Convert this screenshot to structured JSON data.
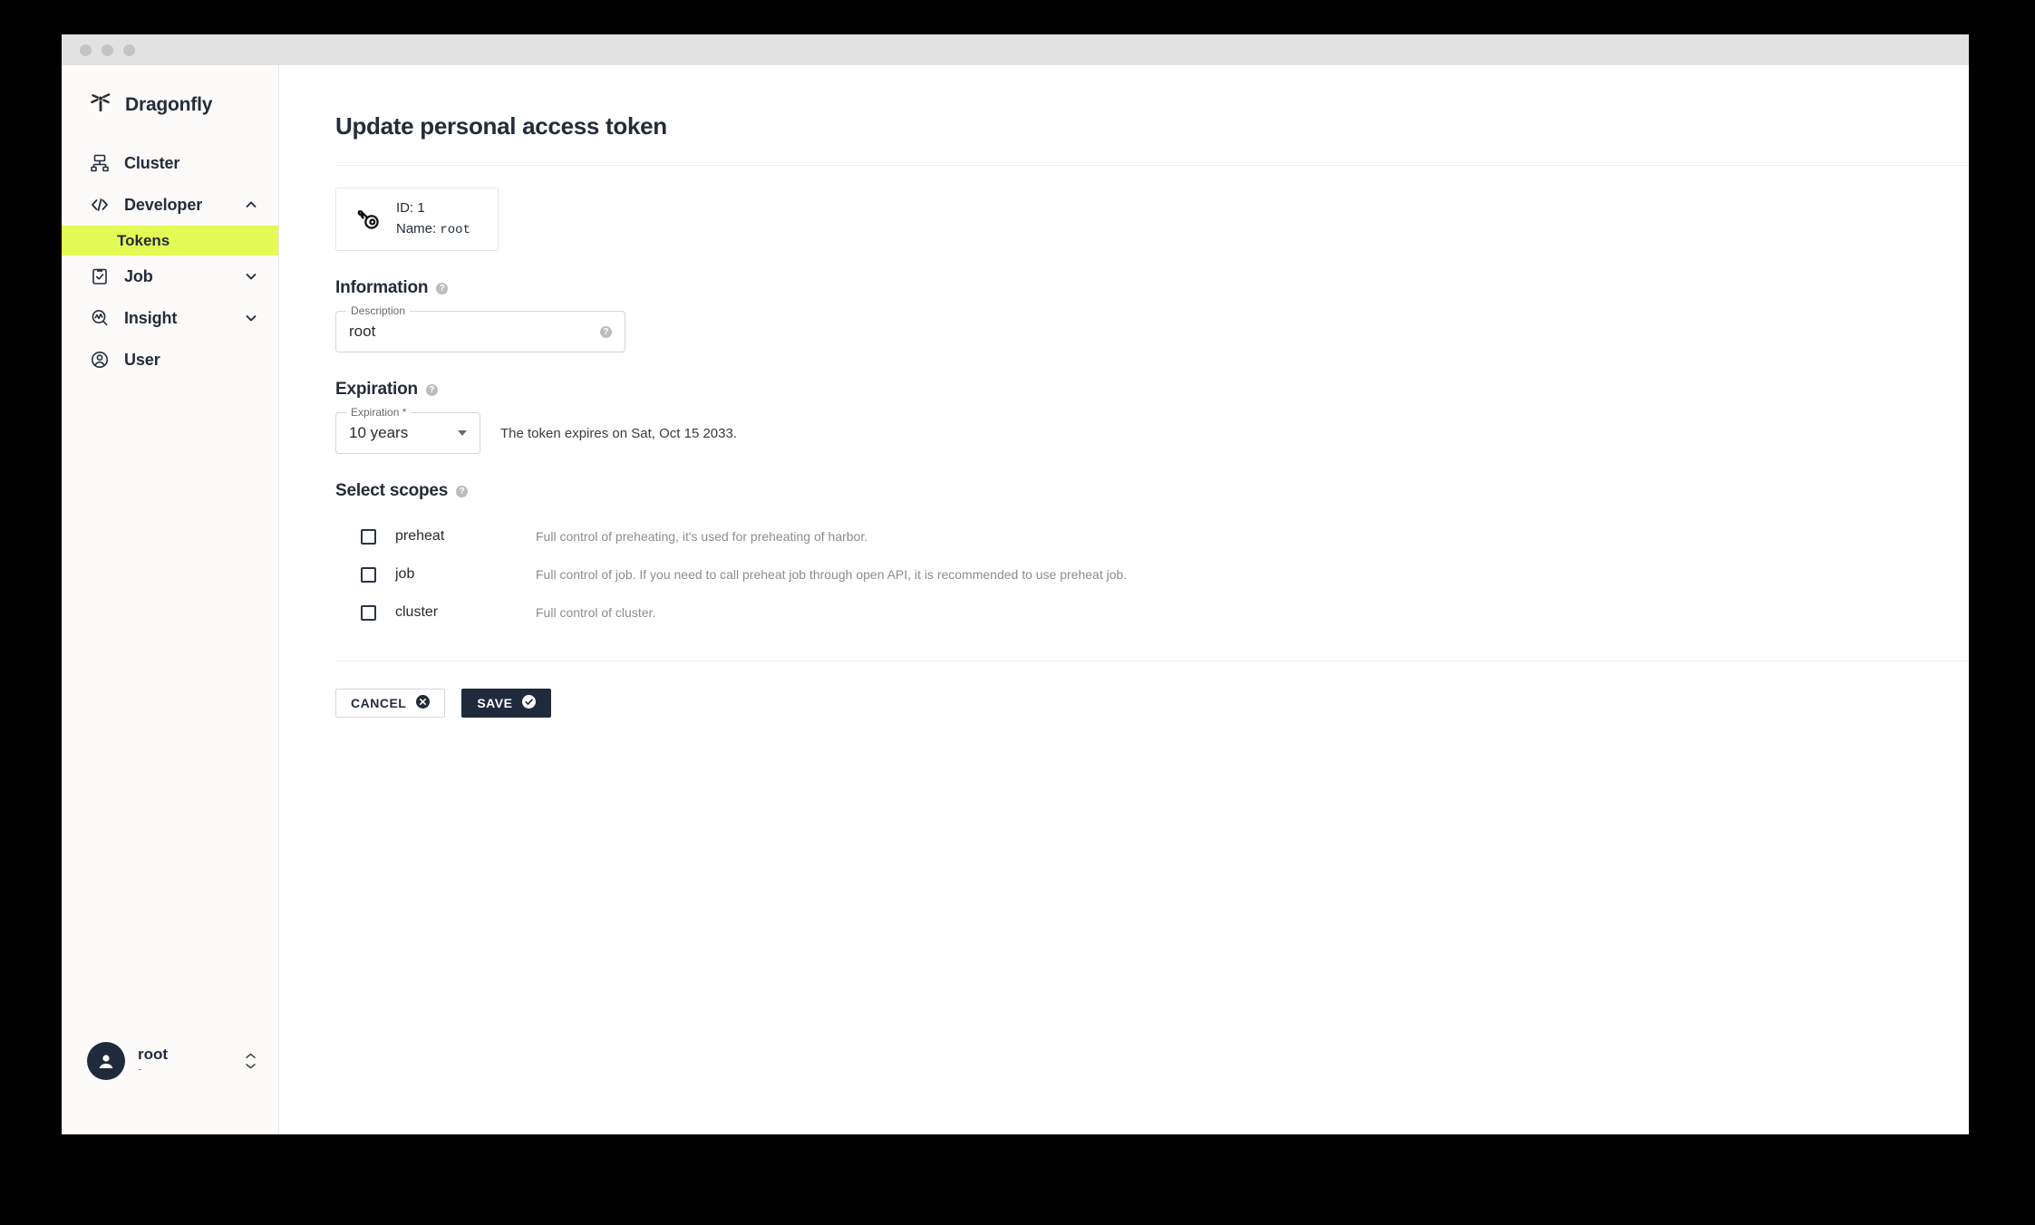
{
  "window": {
    "traffic_lights": [
      "close",
      "minimize",
      "maximize"
    ]
  },
  "sidebar": {
    "brand": {
      "name": "Dragonfly",
      "icon": "dragonfly-logo-icon"
    },
    "items": [
      {
        "label": "Cluster",
        "icon": "cluster-icon",
        "expandable": false,
        "chevron": ""
      },
      {
        "label": "Developer",
        "icon": "code-icon",
        "expandable": true,
        "chevron": "up"
      },
      {
        "label": "Job",
        "icon": "clipboard-check-icon",
        "expandable": true,
        "chevron": "down"
      },
      {
        "label": "Insight",
        "icon": "insight-icon",
        "expandable": true,
        "chevron": "down"
      },
      {
        "label": "User",
        "icon": "user-circle-icon",
        "expandable": false,
        "chevron": ""
      }
    ],
    "sub_items": [
      {
        "label": "Tokens",
        "parent": "Developer",
        "active": true
      }
    ],
    "user": {
      "name": "root",
      "sub": "-",
      "avatar_icon": "person-icon",
      "switcher_icon": "up-down-chevron-icon"
    },
    "colors": {
      "active_highlight": "#e4fa55",
      "background": "#fcfbfa",
      "text": "#242c3a"
    }
  },
  "main": {
    "page_title": "Update personal access token",
    "token_card": {
      "icon": "key-icon",
      "id_line": "ID: 1",
      "name_label": "Name:",
      "name_value": "root"
    },
    "information": {
      "heading": "Information",
      "help_icon": "help-circle-icon",
      "description_field": {
        "legend": "Description",
        "value": "root",
        "placeholder": "Description",
        "help_icon": "help-circle-icon"
      }
    },
    "expiration": {
      "heading": "Expiration",
      "help_icon": "help-circle-icon",
      "select": {
        "legend": "Expiration *",
        "value": "10 years",
        "caret_icon": "chevron-down-icon"
      },
      "note": "The token expires on Sat, Oct 15 2033."
    },
    "scopes": {
      "heading": "Select scopes",
      "help_icon": "help-circle-icon",
      "rows": [
        {
          "name": "preheat",
          "checked": false,
          "description": "Full control of preheating, it's used for preheating of harbor."
        },
        {
          "name": "job",
          "checked": false,
          "description": "Full control of job. If you need to call preheat job through open API, it is recommended to use preheat job."
        },
        {
          "name": "cluster",
          "checked": false,
          "description": "Full control of cluster."
        }
      ]
    },
    "actions": {
      "cancel": {
        "label": "CANCEL",
        "icon": "circle-x-icon"
      },
      "save": {
        "label": "SAVE",
        "icon": "circle-check-icon"
      }
    }
  },
  "colors": {
    "accent": "#e4fa55",
    "navy": "#1f2a3c",
    "muted_text": "#8d8d8d",
    "border": "#e4e4e4"
  }
}
